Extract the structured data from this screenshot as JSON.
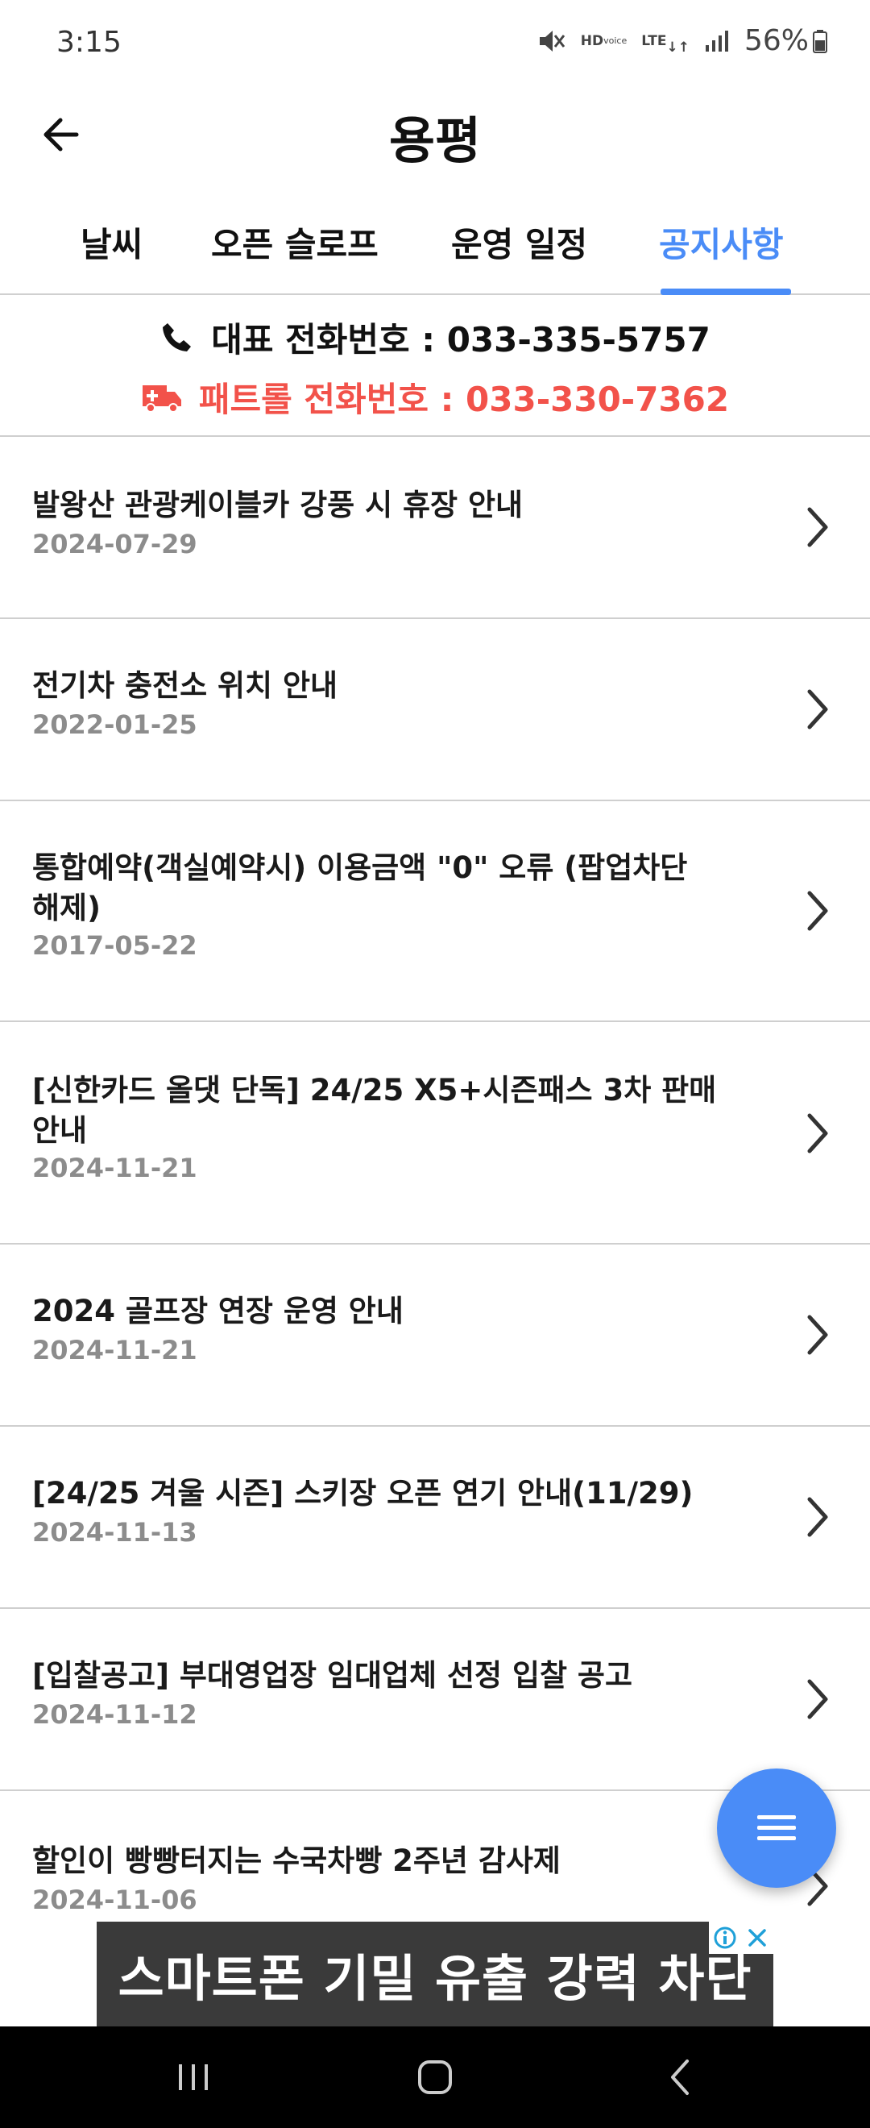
{
  "status_bar": {
    "time": "3:15",
    "hd_top": "HD",
    "hd_bottom": "voice",
    "lte_label": "LTE",
    "battery": "56%"
  },
  "header": {
    "title": "용평"
  },
  "tabs": [
    {
      "label": "날씨",
      "active": false
    },
    {
      "label": "오픈 슬로프",
      "active": false
    },
    {
      "label": "운영 일정",
      "active": false
    },
    {
      "label": "공지사항",
      "active": true
    }
  ],
  "contacts": {
    "main": "대표 전화번호 : 033-335-5757",
    "patrol": "패트롤 전화번호 : 033-330-7362"
  },
  "notices": [
    {
      "title": "발왕산 관광케이블카 강풍 시 휴장 안내",
      "date": "2024-07-29"
    },
    {
      "title": "전기차 충전소 위치 안내",
      "date": "2022-01-25"
    },
    {
      "title": "통합예약(객실예약시)  이용금액 \"0\"  오류 (팝업차단 해제)",
      "date": "2017-05-22"
    },
    {
      "title": "[신한카드 올댓 단독] 24/25 X5+시즌패스 3차 판매 안내",
      "date": "2024-11-21"
    },
    {
      "title": "2024 골프장 연장 운영 안내",
      "date": "2024-11-21"
    },
    {
      "title": "[24/25 겨울 시즌] 스키장 오픈 연기 안내(11/29)",
      "date": "2024-11-13"
    },
    {
      "title": "[입찰공고] 부대영업장 임대업체 선정 입찰 공고",
      "date": "2024-11-12"
    },
    {
      "title": "할인이 빵빵터지는 수국차빵 2주년 감사제",
      "date": "2024-11-06"
    }
  ],
  "ad": {
    "text": "스마트폰 기밀 유출 강력 차단"
  },
  "colors": {
    "accent": "#4a8cf7",
    "patrol": "#f2524a"
  }
}
